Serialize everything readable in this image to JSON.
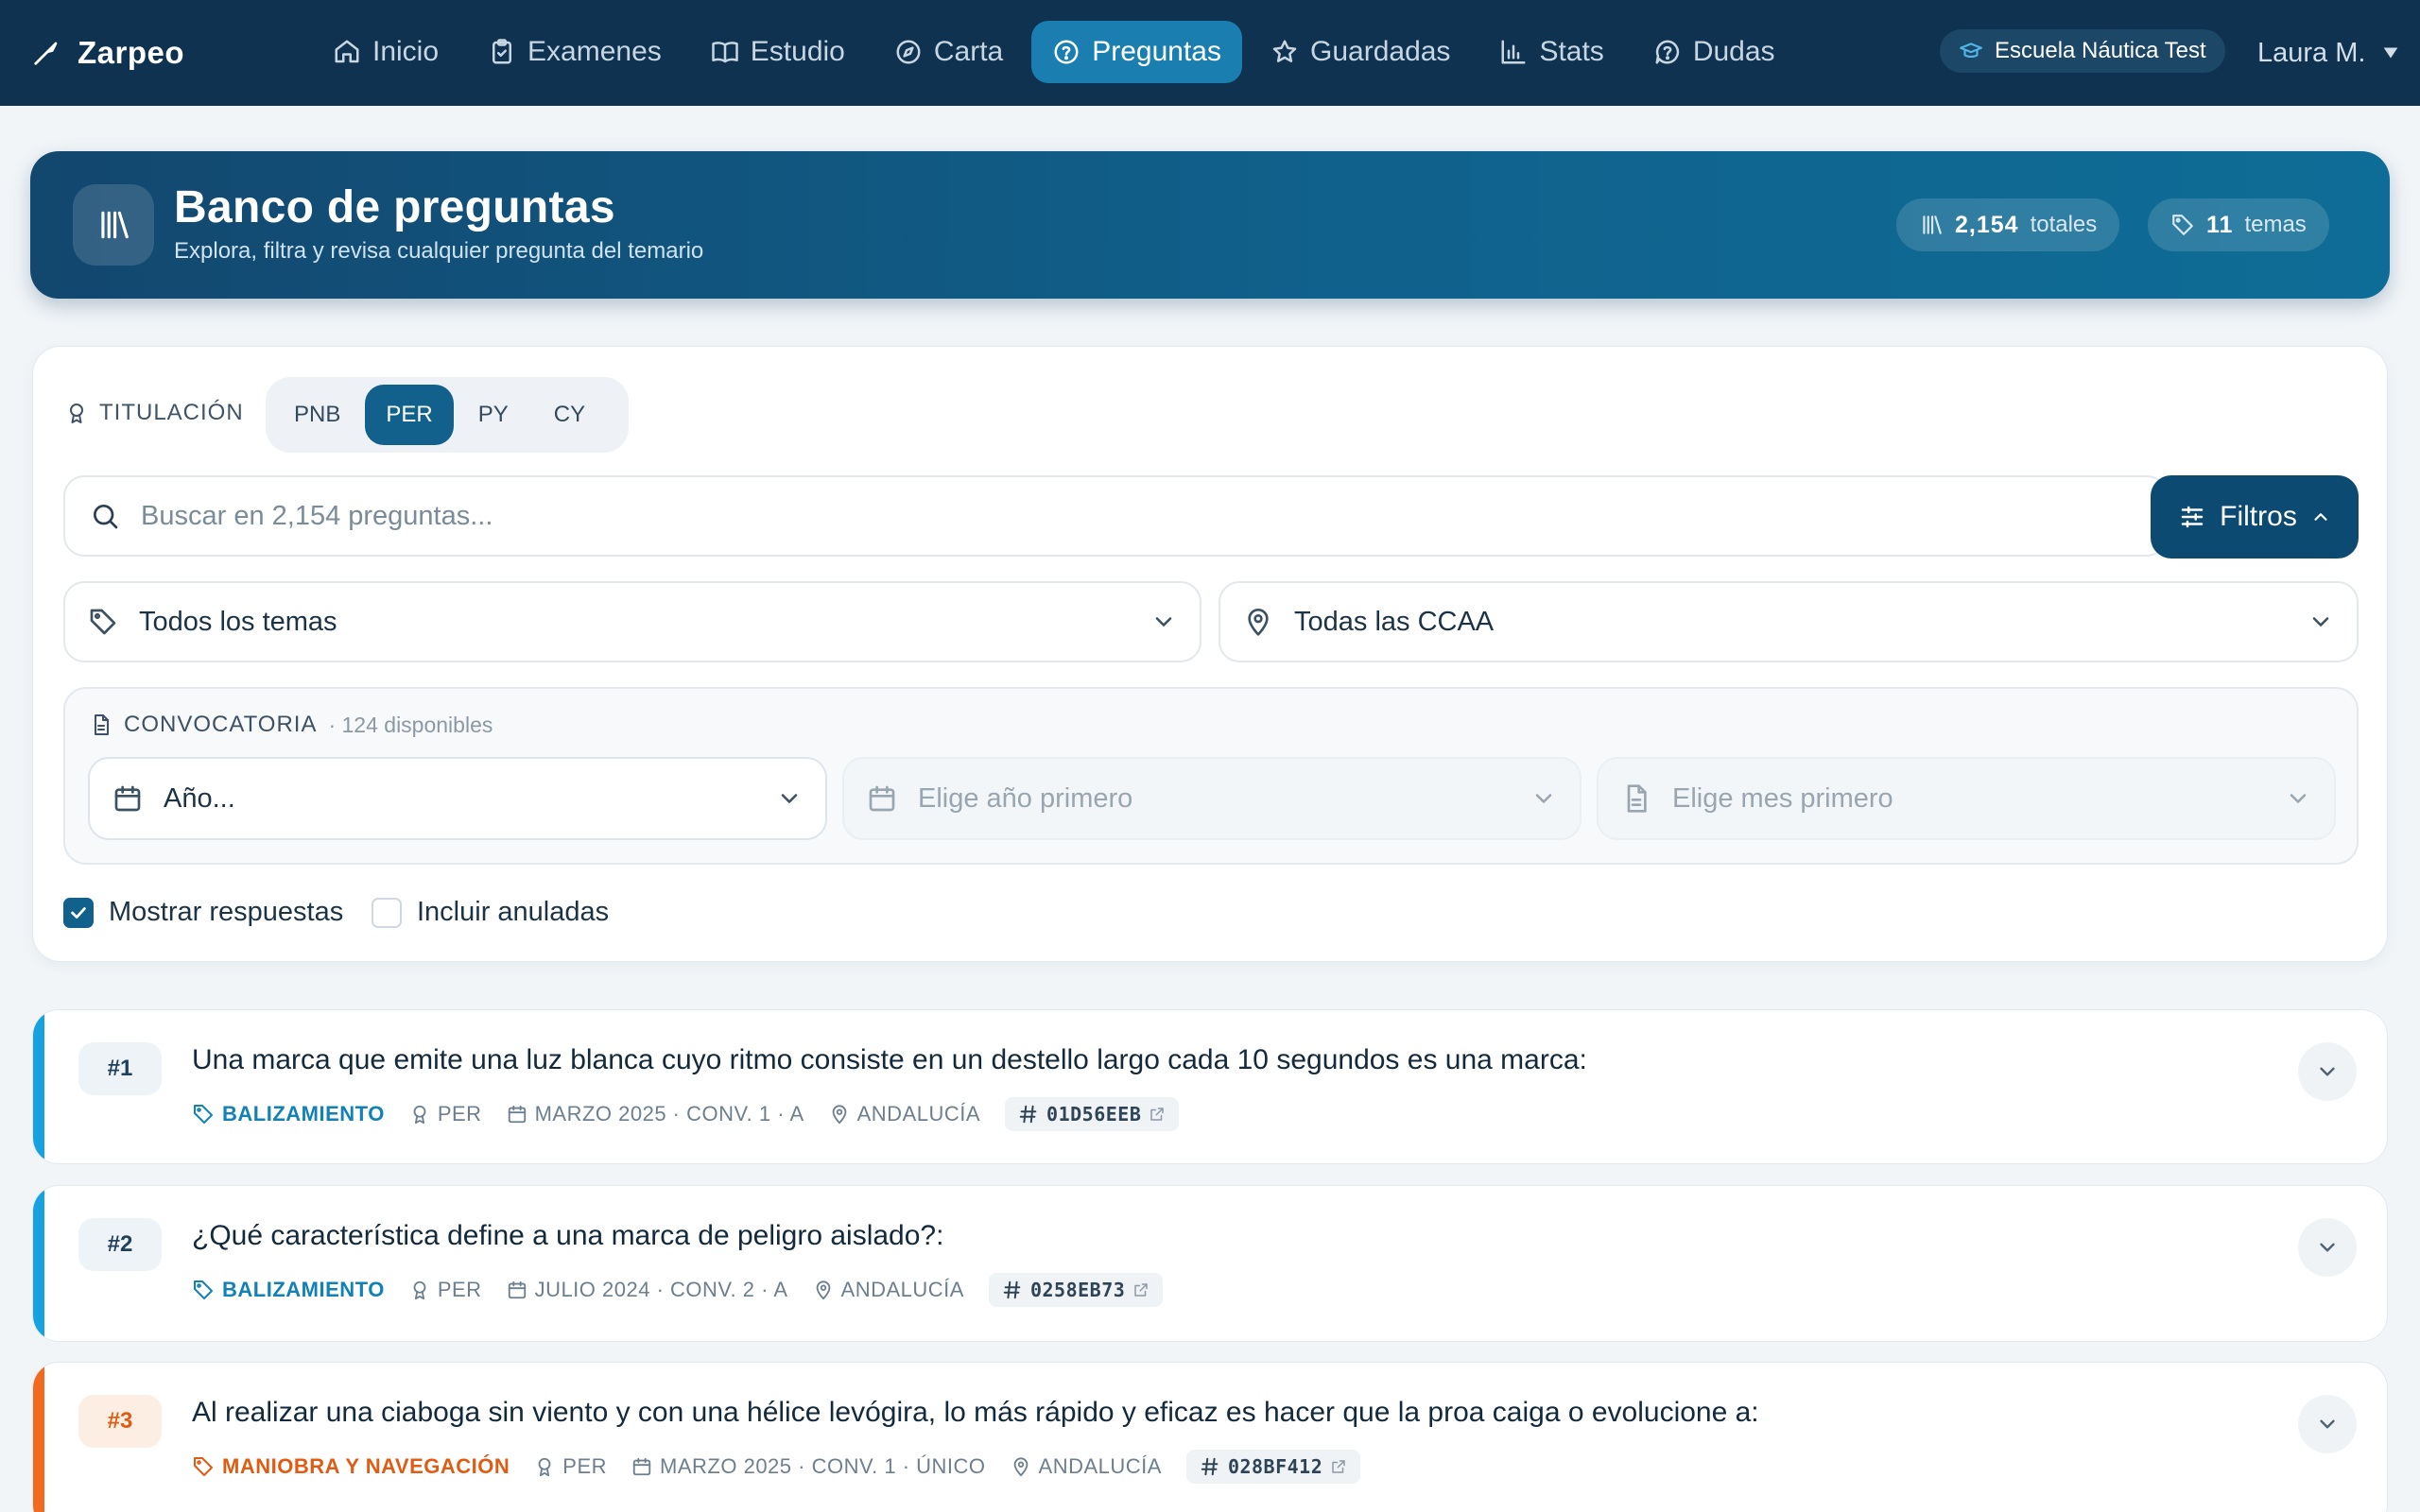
{
  "app": {
    "name": "Zarpeo"
  },
  "nav": {
    "items": [
      {
        "label": "Inicio",
        "icon": "home-icon"
      },
      {
        "label": "Examenes",
        "icon": "clipboard-icon"
      },
      {
        "label": "Estudio",
        "icon": "book-icon"
      },
      {
        "label": "Carta",
        "icon": "compass-icon"
      },
      {
        "label": "Preguntas",
        "icon": "question-icon",
        "active": true
      },
      {
        "label": "Guardadas",
        "icon": "star-icon"
      },
      {
        "label": "Stats",
        "icon": "bar-chart-icon"
      },
      {
        "label": "Dudas",
        "icon": "help-bubble-icon"
      }
    ],
    "school": "Escuela Náutica Test",
    "user": "Laura M."
  },
  "hero": {
    "title": "Banco de preguntas",
    "subtitle": "Explora, filtra y revisa cualquier pregunta del temario",
    "total_count": "2,154",
    "total_label": "totales",
    "topics_count": "11",
    "topics_label": "temas"
  },
  "filters": {
    "titulacion_label": "TITULACIÓN",
    "titulaciones": [
      "PNB",
      "PER",
      "PY",
      "CY"
    ],
    "active_titulacion": "PER",
    "search_placeholder": "Buscar en 2,154 preguntas...",
    "filtros_label": "Filtros",
    "topic_select": "Todos los temas",
    "ccaa_select": "Todas las CCAA",
    "convocatoria_label": "CONVOCATORIA",
    "convocatoria_count": "· 124 disponibles",
    "year_select": "Año...",
    "month_select": "Elige año primero",
    "conv_select": "Elige mes primero",
    "show_answers": "Mostrar respuestas",
    "show_answers_checked": true,
    "include_annulled": "Incluir anuladas",
    "include_annulled_checked": false
  },
  "questions": [
    {
      "num": "#1",
      "text": "Una marca que emite una luz blanca cuyo ritmo consiste en un destello largo cada 10 segundos es una marca:",
      "topic": "BALIZAMIENTO",
      "titulacion": "PER",
      "date": "MARZO 2025 · CONV. 1 · A",
      "region": "ANDALUCÍA",
      "id": "01D56EEB",
      "accent": "#16a2e0"
    },
    {
      "num": "#2",
      "text": "¿Qué característica define a una marca de peligro aislado?:",
      "topic": "BALIZAMIENTO",
      "titulacion": "PER",
      "date": "JULIO 2024 · CONV. 2 · A",
      "region": "ANDALUCÍA",
      "id": "0258EB73",
      "accent": "#16a2e0"
    },
    {
      "num": "#3",
      "text": "Al realizar una ciaboga sin viento y con una hélice levógira, lo más rápido y eficaz es hacer que la proa caiga o evolucione a:",
      "topic": "MANIOBRA Y NAVEGACIÓN",
      "titulacion": "PER",
      "date": "MARZO 2025 · CONV. 1 · ÚNICO",
      "region": "ANDALUCÍA",
      "id": "028BF412",
      "accent": "#f26a1f"
    }
  ]
}
